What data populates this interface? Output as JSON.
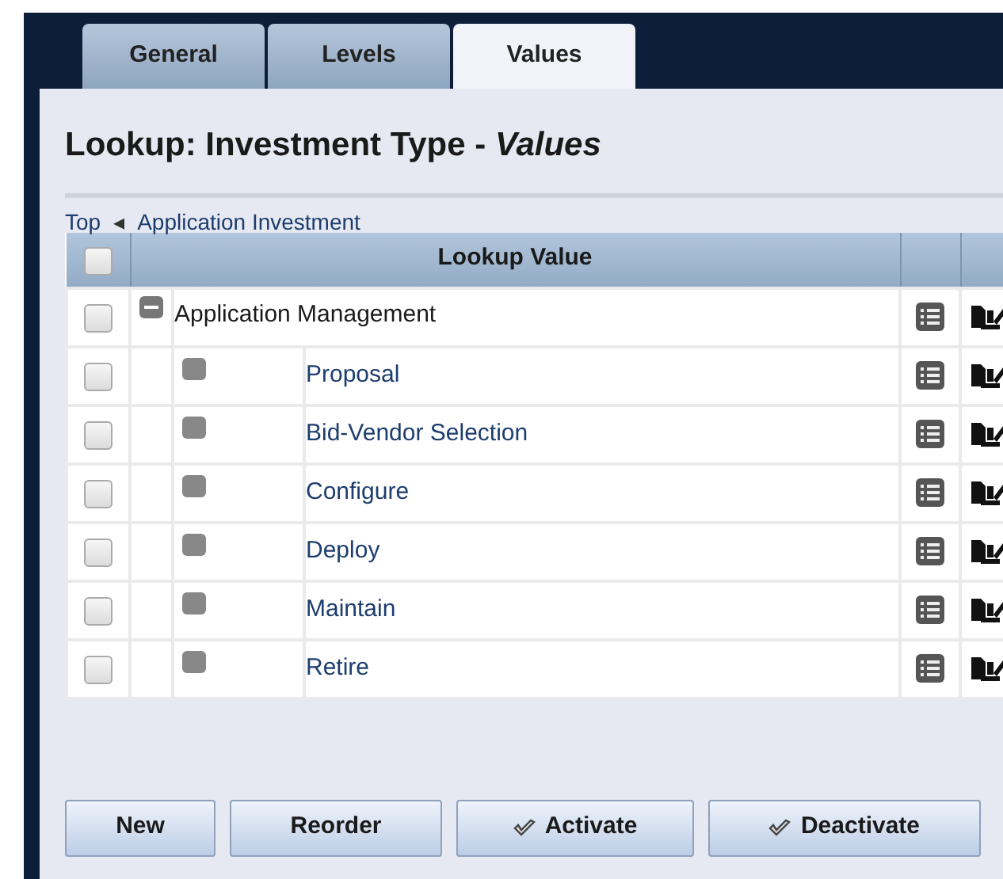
{
  "tabs": [
    {
      "label": "General",
      "selected": false
    },
    {
      "label": "Levels",
      "selected": false
    },
    {
      "label": "Values",
      "selected": true
    }
  ],
  "title": {
    "text": "Lookup: Investment Type - ",
    "emphasis": "Values"
  },
  "breadcrumb": {
    "top": "Top",
    "separator": "◂",
    "current": "Application Investment"
  },
  "table": {
    "select_all": {
      "checked": false
    },
    "columns": [
      "Lookup Value"
    ],
    "rows": [
      {
        "label": "Application Management",
        "checked": false,
        "expanded": true,
        "children": [
          {
            "label": "Proposal",
            "checked": false
          },
          {
            "label": "Bid-Vendor Selection",
            "checked": false
          },
          {
            "label": "Configure",
            "checked": false
          },
          {
            "label": "Deploy",
            "checked": false
          },
          {
            "label": "Maintain",
            "checked": false
          },
          {
            "label": "Retire",
            "checked": false
          }
        ]
      }
    ]
  },
  "buttons": [
    {
      "label": "New",
      "icon": false
    },
    {
      "label": "Reorder",
      "icon": false
    },
    {
      "label": "Activate",
      "icon": true
    },
    {
      "label": "Deactivate",
      "icon": true
    }
  ]
}
